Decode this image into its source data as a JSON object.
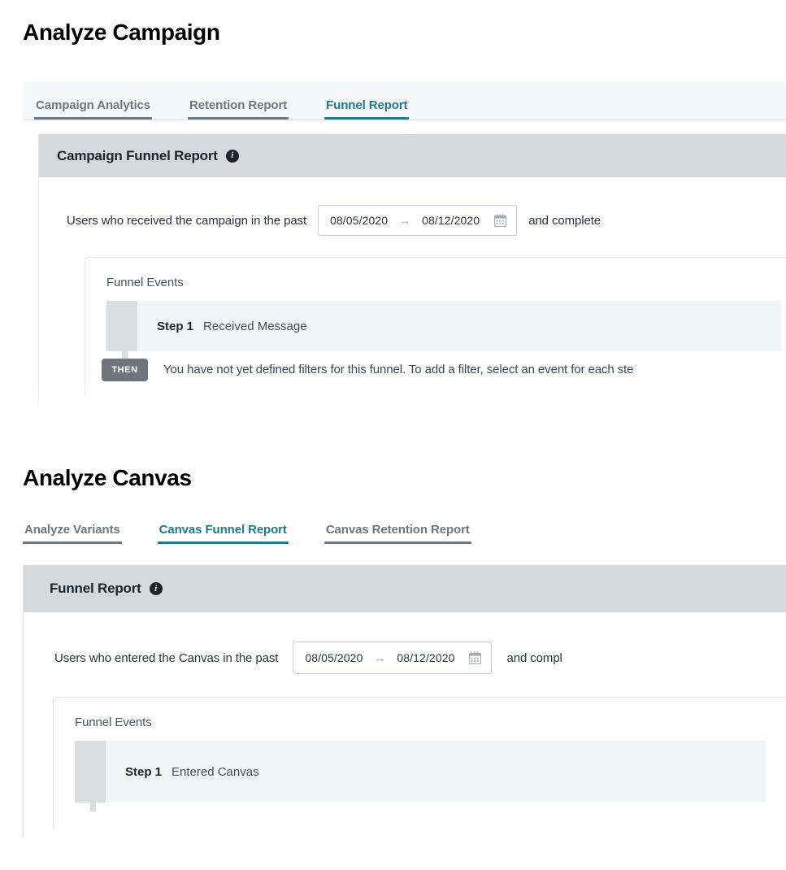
{
  "sections": [
    {
      "title": "Analyze Campaign",
      "tabs": [
        {
          "label": "Campaign Analytics",
          "active": false
        },
        {
          "label": "Retention Report",
          "active": false
        },
        {
          "label": "Funnel Report",
          "active": true
        }
      ],
      "card": {
        "header_title": "Campaign Funnel Report",
        "info_icon": "info-icon",
        "criteria_prefix": "Users who received the campaign in the past",
        "criteria_suffix": "and complete",
        "date_range": {
          "start": "08/05/2020",
          "arrow": "→",
          "end": "08/12/2020",
          "calendar_icon": "calendar-icon"
        },
        "funnel": {
          "label": "Funnel Events",
          "steps": [
            {
              "number": "Step 1",
              "name": "Received Message"
            }
          ],
          "then_badge": "THEN",
          "then_text": "You have not yet defined filters for this funnel. To add a filter, select an event for each ste"
        }
      }
    },
    {
      "title": "Analyze Canvas",
      "tabs": [
        {
          "label": "Analyze Variants",
          "active": false
        },
        {
          "label": "Canvas Funnel Report",
          "active": true
        },
        {
          "label": "Canvas Retention Report",
          "active": false
        }
      ],
      "card": {
        "header_title": "Funnel Report",
        "info_icon": "info-icon",
        "criteria_prefix": "Users who entered the Canvas in the past",
        "criteria_suffix": "and compl",
        "date_range": {
          "start": "08/05/2020",
          "arrow": "→",
          "end": "08/12/2020",
          "calendar_icon": "calendar-icon"
        },
        "funnel": {
          "label": "Funnel Events",
          "steps": [
            {
              "number": "Step 1",
              "name": "Entered Canvas"
            }
          ]
        }
      }
    }
  ],
  "colors": {
    "accent_teal": "#21798e",
    "tab_inactive": "#6b7783",
    "card_header_bg": "#d5d9de",
    "step_handle": "#dcdde2",
    "step_row_bg": "#f3f4f6",
    "then_badge_bg": "#6f757c",
    "page_bg": "#ffffff"
  }
}
